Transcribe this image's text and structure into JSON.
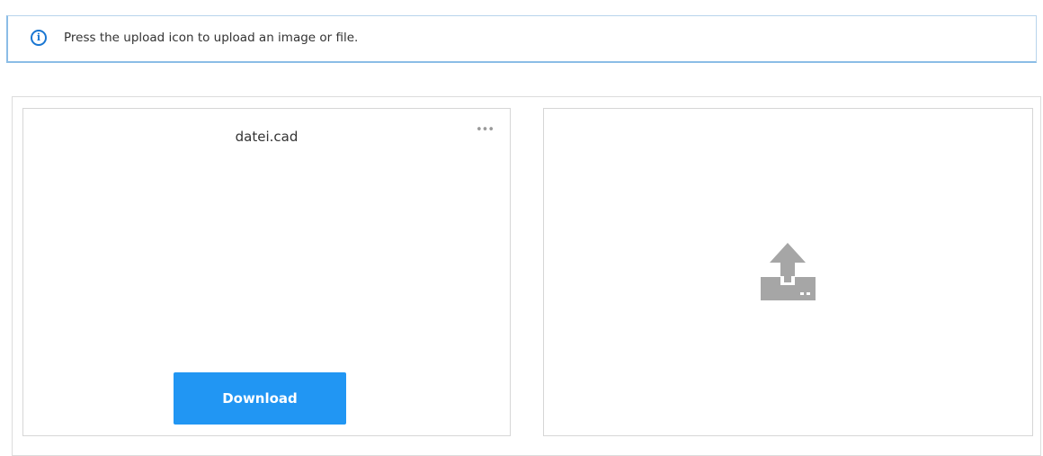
{
  "banner": {
    "icon": "info-icon",
    "icon_glyph": "i",
    "text": "Press the upload icon to upload an image or file."
  },
  "file_card": {
    "file_name": "datei.cad",
    "more_icon": "more-horizontal-icon",
    "more_glyph": "•••",
    "download_label": "Download",
    "download_color": "#2196f3"
  },
  "upload_card": {
    "icon": "upload-icon",
    "icon_color": "#a6a6a6"
  }
}
